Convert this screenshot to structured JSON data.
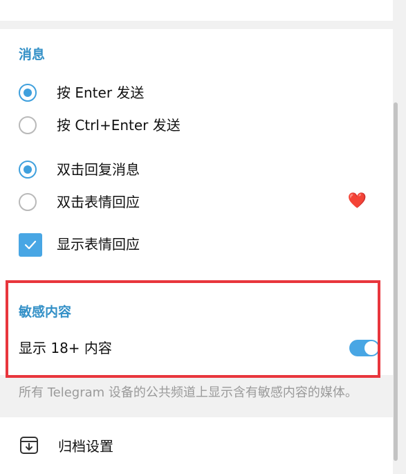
{
  "messages": {
    "title": "消息",
    "send_options": [
      {
        "label": "按 Enter 发送",
        "selected": true
      },
      {
        "label": "按 Ctrl+Enter 发送",
        "selected": false
      }
    ],
    "double_click_options": [
      {
        "label": "双击回复消息",
        "selected": true
      },
      {
        "label": "双击表情回应",
        "selected": false
      }
    ],
    "reaction_emoji": "❤️",
    "show_reactions": {
      "label": "显示表情回应",
      "checked": true
    }
  },
  "sensitive": {
    "title": "敏感内容",
    "show_18_label": "显示 18+ 内容",
    "show_18_enabled": true,
    "hint": "所有 Telegram 设备的公共频道上显示含有敏感内容的媒体。"
  },
  "archive": {
    "label": "归档设置",
    "icon": "archive-icon"
  },
  "colors": {
    "accent": "#3390c7",
    "highlight_frame": "#e8363d"
  }
}
